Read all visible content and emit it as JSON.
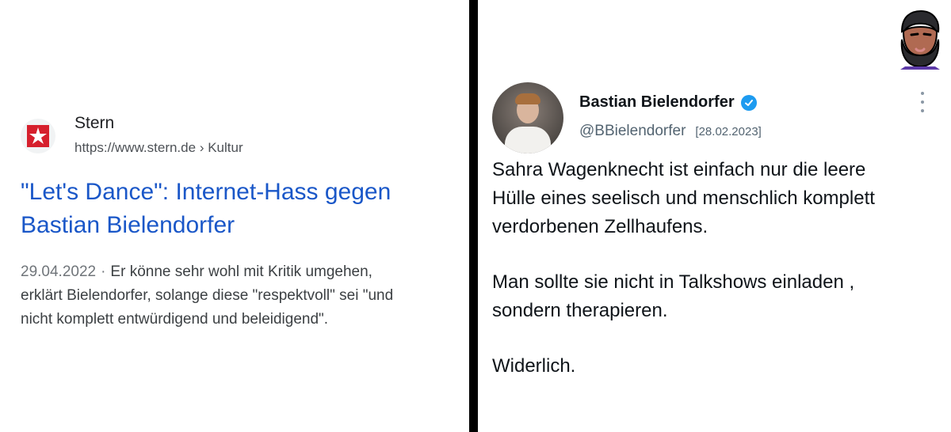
{
  "search_result": {
    "site_name": "Stern",
    "url": "https://www.stern.de",
    "breadcrumb_sep": "›",
    "breadcrumb": "Kultur",
    "title_line1": "\"Let's Dance\": Internet-Hass gegen",
    "title_line2": "Bastian Bielendorfer",
    "date": "29.04.2022",
    "separator": "·",
    "snippet_line1": "Er könne sehr wohl mit Kritik umgehen,",
    "snippet_line2": "erklärt Bielendorfer, solange diese \"respektvoll\" sei \"und",
    "snippet_line3": "nicht komplett entwürdigend und beleidigend\".",
    "favicon_icon": "stern-logo-icon",
    "colors": {
      "title": "#1a57c8",
      "favicon": "#d6202d"
    }
  },
  "tweet": {
    "author_name": "Bastian Bielendorfer",
    "handle": "@BBielendorfer",
    "date": "[28.02.2023]",
    "verified_icon": "verified-badge-icon",
    "more_icon": "more-options-icon",
    "line1": "Sahra Wagenknecht ist einfach nur die leere",
    "line2": "Hülle eines seelisch und menschlich komplett",
    "line3": "verdorbenen Zellhaufens.",
    "line4": "Man sollte sie nicht in Talkshows einladen ,",
    "line5": "sondern therapieren.",
    "line6": "Widerlich.",
    "colors": {
      "verified": "#1d9bf0",
      "handle": "#536471"
    }
  },
  "corner": {
    "icon": "bearded-man-mascot-icon"
  }
}
